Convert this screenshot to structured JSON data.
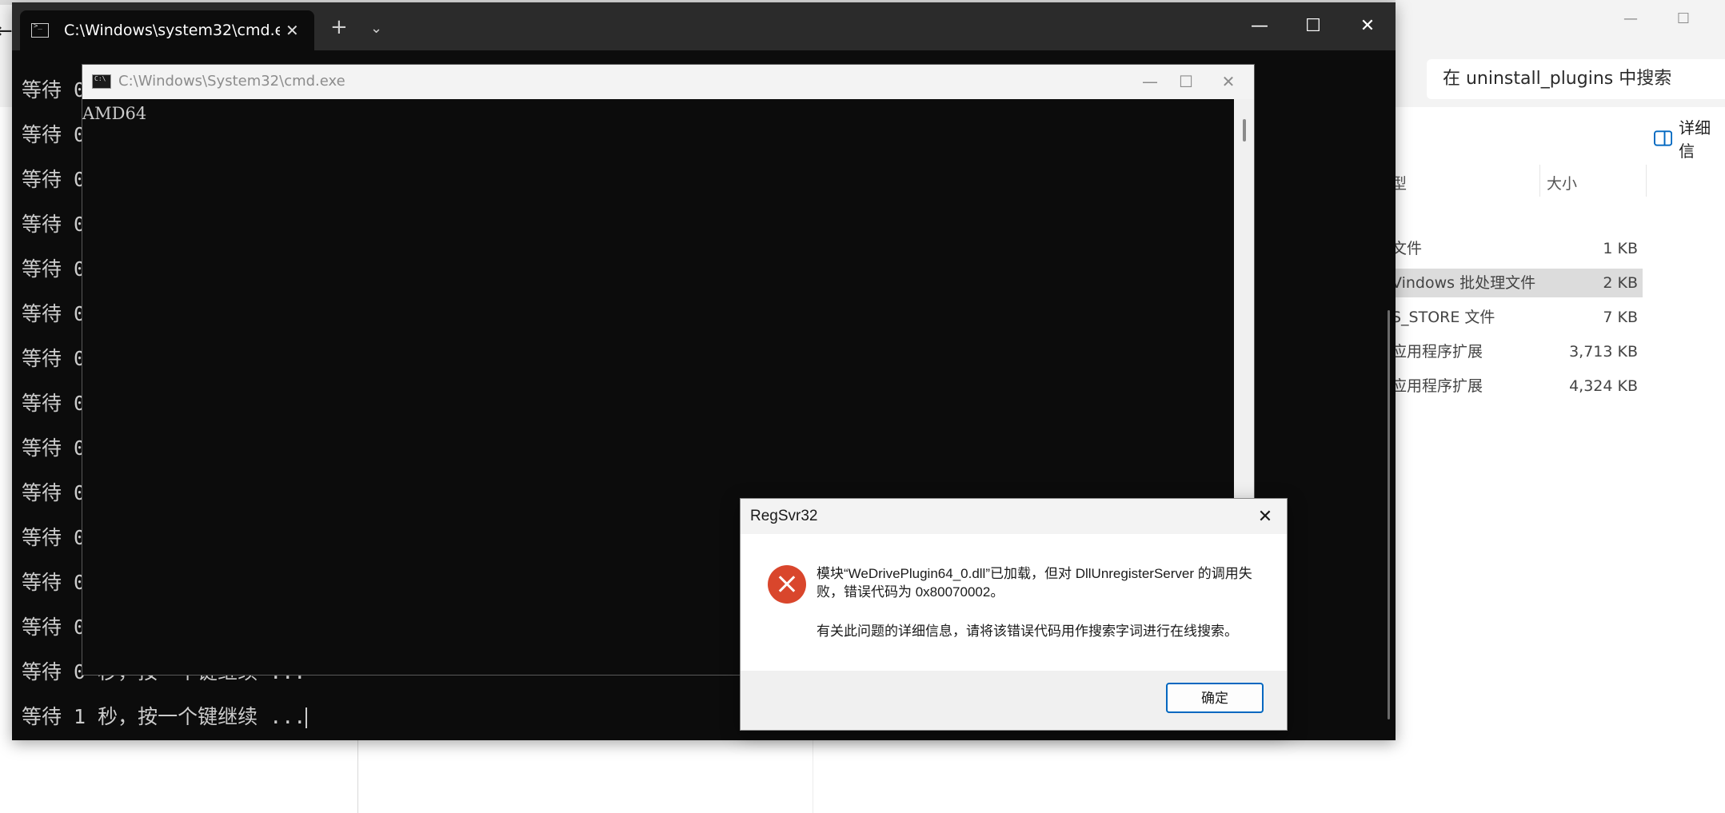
{
  "explorer": {
    "search_placeholder": "在 uninstall_plugins 中搜索",
    "details_label": "详细信",
    "columns": {
      "type": "型",
      "size": "大小"
    },
    "rows": [
      {
        "type": "文件",
        "size": "1 KB"
      },
      {
        "type": "Vindows 批处理文件",
        "size": "2 KB"
      },
      {
        "type": "S_STORE 文件",
        "size": "7 KB"
      },
      {
        "type": "应用程序扩展",
        "size": "3,713 KB"
      },
      {
        "type": "应用程序扩展",
        "size": "4,324 KB"
      }
    ],
    "min_glyph": "—",
    "max_glyph": "☐",
    "back_glyph": "←"
  },
  "terminal": {
    "tab_title": "C:\\Windows\\system32\\cmd.exe",
    "tab_close": "✕",
    "new_tab": "+",
    "dropdown": "⌄",
    "min": "—",
    "max": "☐",
    "close": "✕",
    "lines": [
      "等待 0",
      "等待 0",
      "等待 0",
      "等待 0",
      "等待 0",
      "等待 0",
      "等待 0",
      "等待 0",
      "等待 0",
      "等待 0",
      "等待 0",
      "等待 0",
      "等待 0",
      "等待 0 秒，按一个键继续 ...",
      "等待 1 秒，按一个键继续 ..."
    ]
  },
  "conhost": {
    "title": "C:\\Windows\\System32\\cmd.exe",
    "output": "AMD64",
    "min": "—",
    "max": "☐",
    "close": "✕"
  },
  "dialog": {
    "title": "RegSvr32",
    "close": "✕",
    "message": "模块“WeDrivePlugin64_0.dll”已加载，但对 DllUnregisterServer 的调用失败，错误代码为 0x80070002。",
    "detail": "有关此问题的详细信息，请将该错误代码用作搜索字词进行在线搜索。",
    "ok_label": "确定",
    "accent": "#0067c0",
    "error_color": "#d9462c"
  }
}
